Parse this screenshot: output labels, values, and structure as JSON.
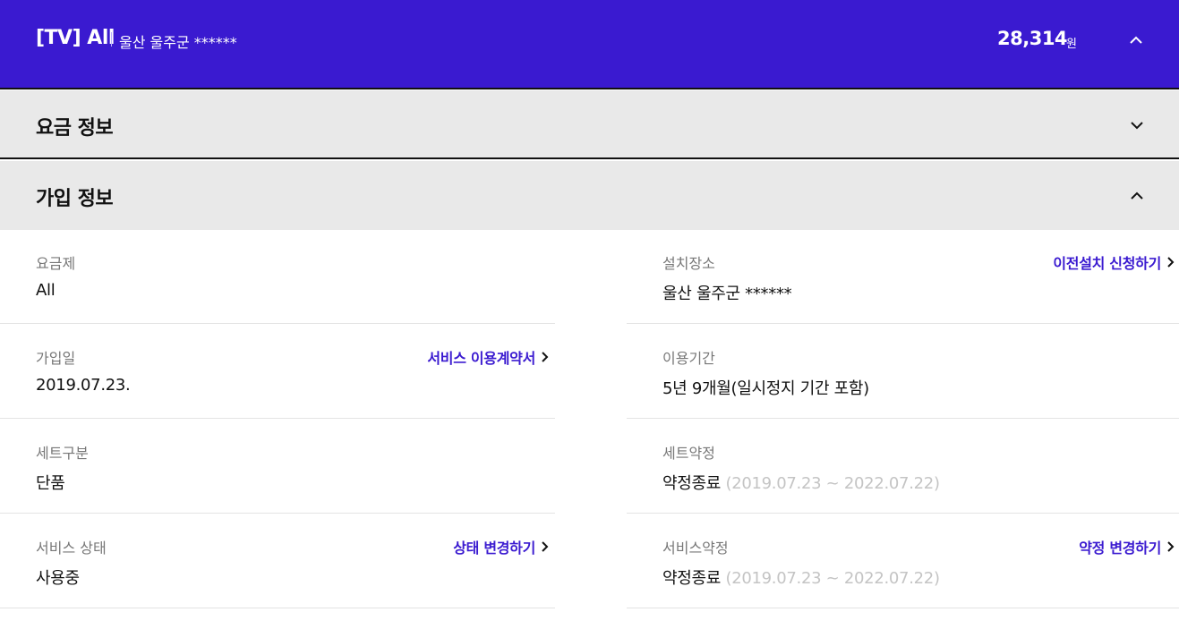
{
  "header": {
    "title": "[TV] All",
    "location": "울산 울주군 ******",
    "amount": "28,314",
    "unit": "원",
    "toggle_icon": "chevron-up-icon"
  },
  "sections": {
    "fee": {
      "title": "요금 정보",
      "toggle_icon": "chevron-down-icon"
    },
    "join": {
      "title": "가입 정보",
      "toggle_icon": "chevron-up-icon"
    }
  },
  "details": {
    "plan": {
      "label": "요금제",
      "value": "All"
    },
    "install_location": {
      "label": "설치장소",
      "value": "울산 울주군 ******",
      "link": "이전설치 신청하기"
    },
    "join_date": {
      "label": "가입일",
      "value": "2019.07.23.",
      "link": "서비스 이용계약서"
    },
    "usage_period": {
      "label": "이용기간",
      "value": "5년 9개월(일시정지 기간 포함)"
    },
    "set_type": {
      "label": "세트구분",
      "value": "단품"
    },
    "set_contract": {
      "label": "세트약정",
      "value": "약정종료",
      "period": "(2019.07.23 ~ 2022.07.22)"
    },
    "service_status": {
      "label": "서비스 상태",
      "value": "사용중",
      "link": "상태 변경하기"
    },
    "service_contract": {
      "label": "서비스약정",
      "value": "약정종료",
      "period": "(2019.07.23 ~ 2022.07.22)",
      "link": "약정 변경하기"
    }
  },
  "colors": {
    "brand": "#3a1ad0",
    "section_bg": "#e9e9e9",
    "muted": "#777777",
    "period": "#c4c4c4"
  }
}
